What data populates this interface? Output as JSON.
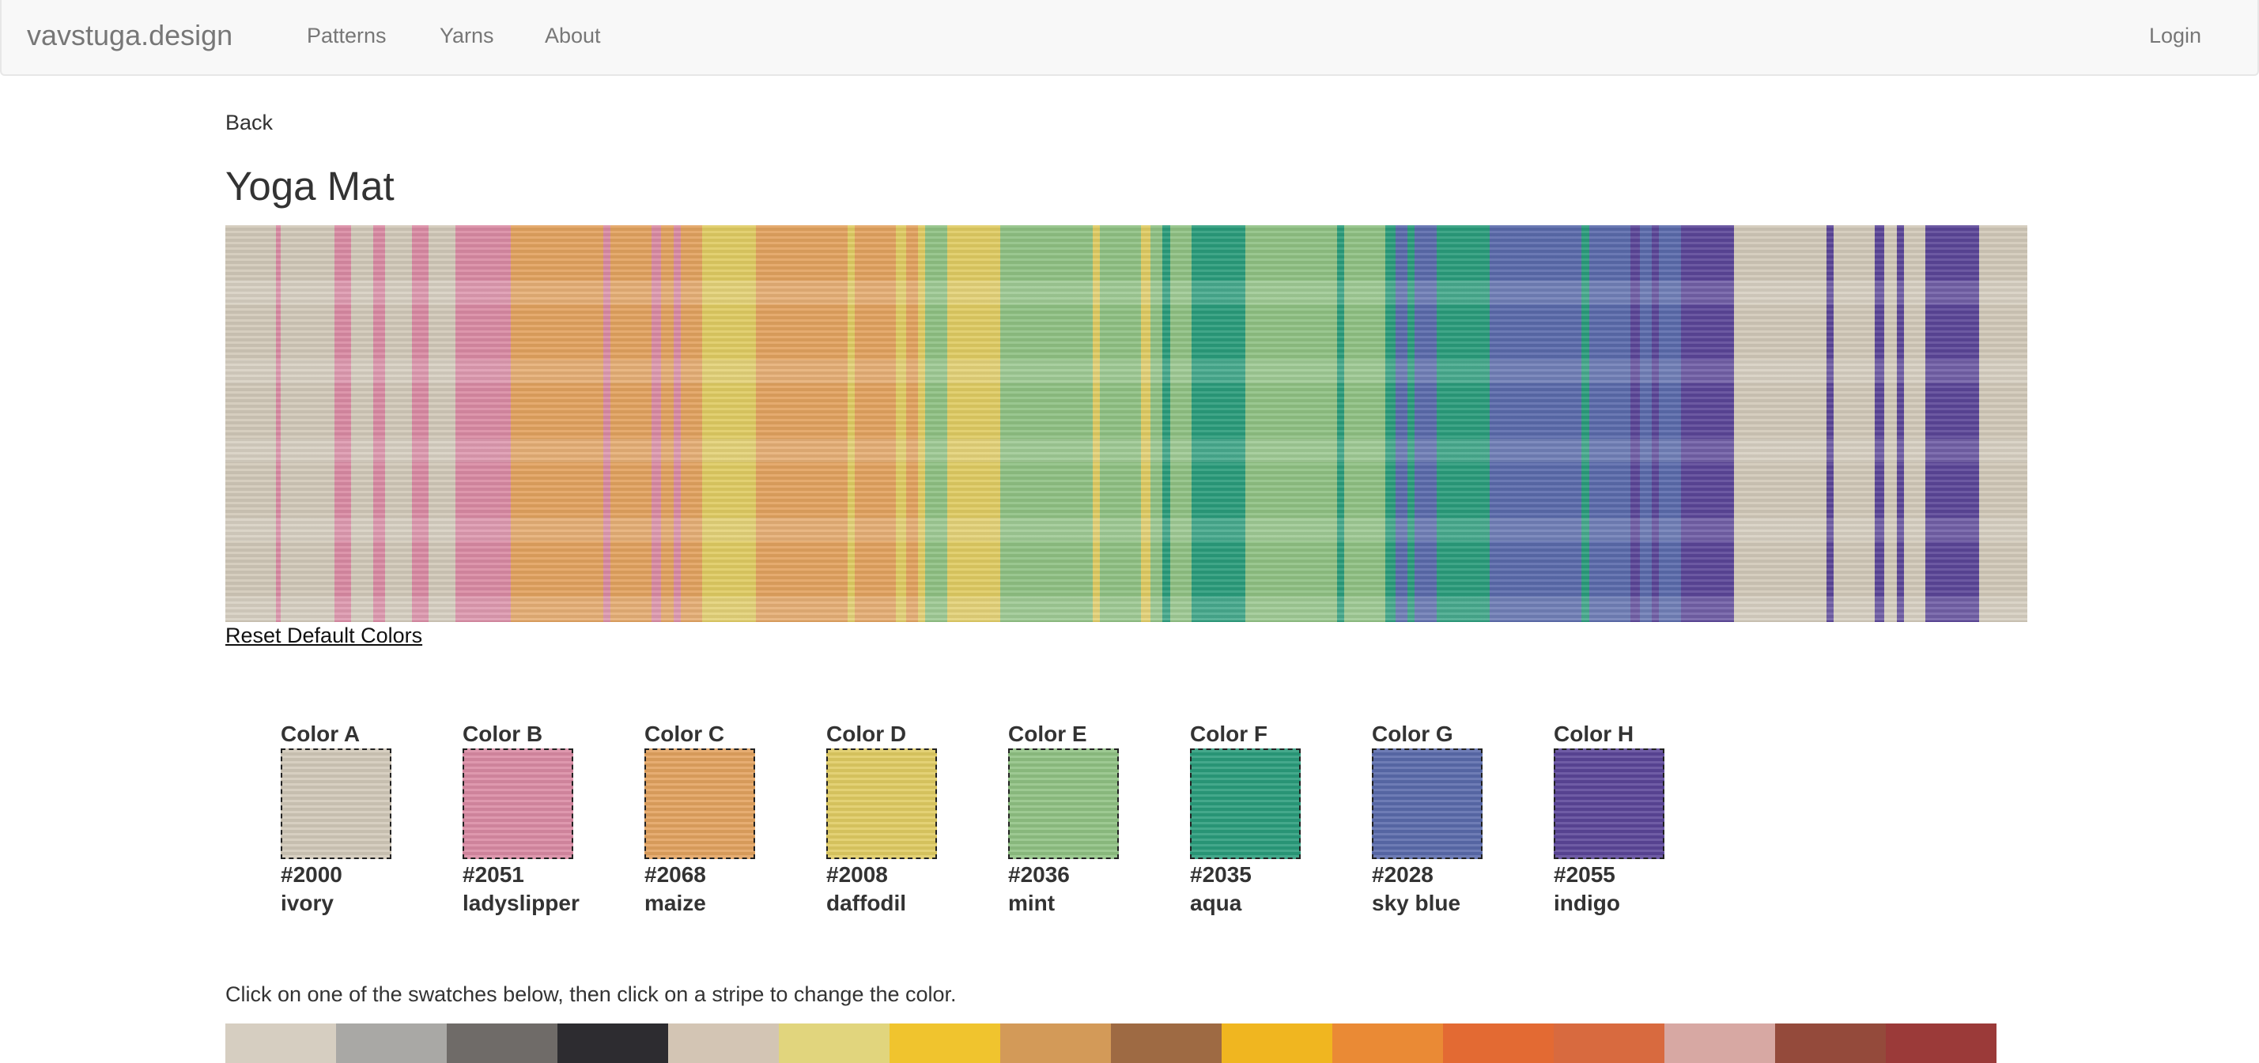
{
  "navbar": {
    "brand": "vavstuga.design",
    "links": [
      "Patterns",
      "Yarns",
      "About"
    ],
    "login": "Login"
  },
  "page": {
    "back": "Back",
    "title": "Yoga Mat",
    "reset": "Reset Default Colors",
    "instruction": "Click on one of the swatches below, then click on a stripe to change the color."
  },
  "colors": [
    {
      "label": "Color A",
      "code": "#2000",
      "name": "ivory",
      "hex": "#d1c8b8"
    },
    {
      "label": "Color B",
      "code": "#2051",
      "name": "ladyslipper",
      "hex": "#d98aa3"
    },
    {
      "label": "Color C",
      "code": "#2068",
      "name": "maize",
      "hex": "#e2a25f"
    },
    {
      "label": "Color D",
      "code": "#2008",
      "name": "daffodil",
      "hex": "#dfcb62"
    },
    {
      "label": "Color E",
      "code": "#2036",
      "name": "mint",
      "hex": "#8fc183"
    },
    {
      "label": "Color F",
      "code": "#2035",
      "name": "aqua",
      "hex": "#2a9c7b"
    },
    {
      "label": "Color G",
      "code": "#2028",
      "name": "sky blue",
      "hex": "#5a6aab"
    },
    {
      "label": "Color H",
      "code": "#2055",
      "name": "indigo",
      "hex": "#5b4698"
    }
  ],
  "stripes": [
    "A",
    "B",
    "A",
    "B",
    "A",
    "B",
    "A",
    "B",
    "A",
    "B",
    "C",
    "B",
    "C",
    "B",
    "C",
    "B",
    "C",
    "D",
    "C",
    "D",
    "C",
    "D",
    "C",
    "D",
    "E",
    "D",
    "E",
    "D",
    "E",
    "D",
    "E",
    "F",
    "E",
    "F",
    "E",
    "F",
    "E",
    "F",
    "G",
    "F",
    "G",
    "F",
    "G",
    "F",
    "G",
    "H",
    "G",
    "H",
    "G",
    "H",
    "A",
    "H",
    "A",
    "H",
    "A",
    "H",
    "A",
    "H",
    "A"
  ],
  "palette": [
    "#d6cec1",
    "#a9a8a5",
    "#6f6b68",
    "#2d2c30",
    "#d3c5b4",
    "#e1d57d",
    "#f0c42e",
    "#d39a58",
    "#9e6a43",
    "#f0b620",
    "#ea8a35",
    "#e36a33",
    "#d86a3f",
    "#d7a8a3",
    "#944a3b",
    "#9b3a39"
  ]
}
